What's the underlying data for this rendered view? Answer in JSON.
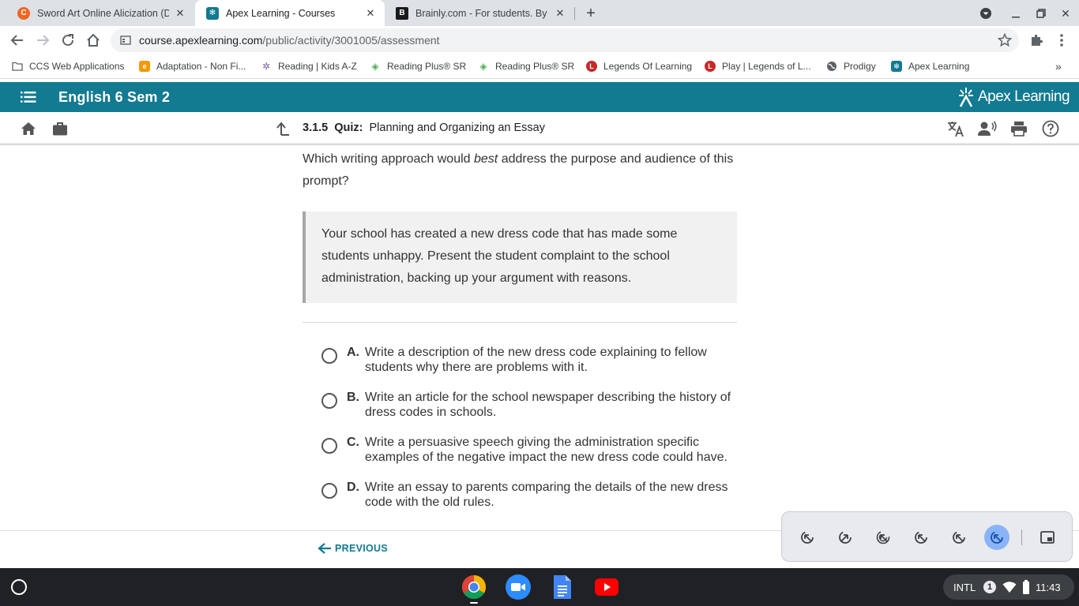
{
  "tabs": [
    {
      "title": "Sword Art Online Alicization (Dut",
      "favicon_color": "#f26522",
      "favicon_glyph": "C"
    },
    {
      "title": "Apex Learning - Courses",
      "favicon_color": "#127a91",
      "favicon_glyph": "✻"
    },
    {
      "title": "Brainly.com - For students. By st",
      "favicon_color": "#1a1a1a",
      "favicon_glyph": "B"
    }
  ],
  "address": {
    "host": "course.apexlearning.com",
    "path": "/public/activity/3001005/assessment"
  },
  "bookmarks": [
    {
      "label": "CCS Web Applications",
      "icon": "folder-icon",
      "color": "#5f6368"
    },
    {
      "label": "Adaptation - Non Fi...",
      "icon": "e-icon",
      "color": "#f29900"
    },
    {
      "label": "Reading | Kids A-Z",
      "icon": "kids-az-icon",
      "color": "#7b61a8"
    },
    {
      "label": "Reading Plus® SR",
      "icon": "reading-plus-icon",
      "color": "#4caf50"
    },
    {
      "label": "Reading Plus® SR",
      "icon": "reading-plus-icon",
      "color": "#4caf50"
    },
    {
      "label": "Legends Of Learning",
      "icon": "legends-icon",
      "color": "#c62828"
    },
    {
      "label": "Play | Legends of L...",
      "icon": "legends-icon",
      "color": "#c62828"
    },
    {
      "label": "Prodigy",
      "icon": "globe-icon",
      "color": "#5f6368"
    },
    {
      "label": "Apex Learning",
      "icon": "apex-icon",
      "color": "#127a91"
    }
  ],
  "header": {
    "course_title": "English 6 Sem 2",
    "brand": "Apex Learning"
  },
  "activity": {
    "number": "3.1.5",
    "type": "Quiz:",
    "title": "Planning and Organizing an Essay"
  },
  "question": {
    "pre": "Which writing approach would ",
    "emph": "best",
    "post": " address the purpose and audience of this prompt?"
  },
  "prompt_text": "Your school has created a new dress code that has made some students unhappy. Present the student complaint to the school administration, backing up your argument with reasons.",
  "choices": [
    {
      "letter": "A.",
      "text": "Write a description of the new dress code explaining to fellow students why there are problems with it."
    },
    {
      "letter": "B.",
      "text": "Write an article for the school newspaper describing the history of dress codes in schools."
    },
    {
      "letter": "C.",
      "text": "Write a persuasive speech giving the administration specific examples of the negative impact the new dress code could have."
    },
    {
      "letter": "D.",
      "text": "Write an essay to parents comparing the details of the new dress code with the old rules."
    }
  ],
  "footer": {
    "previous_label": "PREVIOUS"
  },
  "status": {
    "ime": "INTL",
    "notifications": "1",
    "time": "11:43"
  },
  "colors": {
    "apex_teal": "#127a91",
    "selected_tool": "#8ab4f8"
  }
}
